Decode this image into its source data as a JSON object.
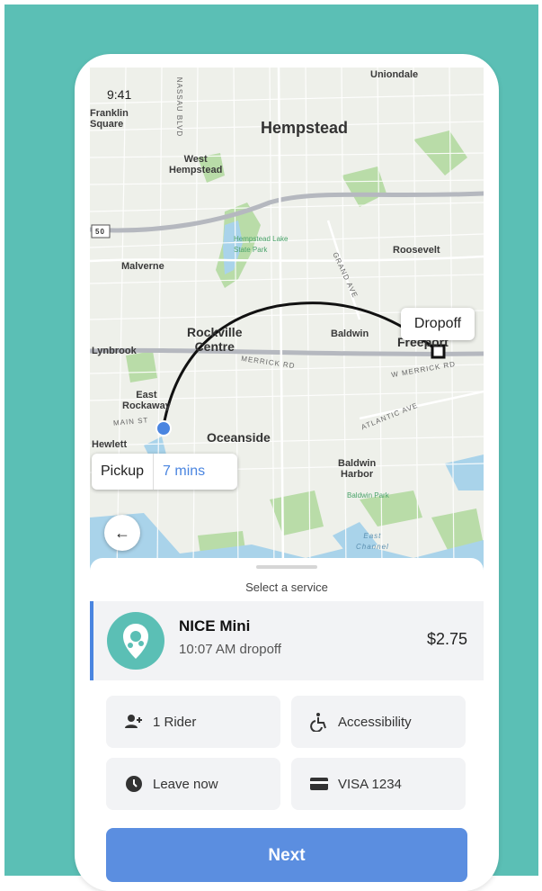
{
  "status": {
    "time": "9:41"
  },
  "map": {
    "labels": {
      "uniondale": "Uniondale",
      "franklin_square": "Franklin\nSquare",
      "nassau_blvd": "NASSAU BLVD",
      "hempstead": "Hempstead",
      "west_hempstead": "West\nHempstead",
      "hempstead_lake": "Hempstead Lake\nState Park",
      "malverne": "Malverne",
      "roosevelt": "Roosevelt",
      "grand_ave": "GRAND AVE",
      "rockville_centre": "Rockville\nCentre",
      "baldwin": "Baldwin",
      "freeport": "Freeport",
      "lynbrook": "Lynbrook",
      "merrick_rd": "MERRICK RD",
      "w_merrick_rd": "W MERRICK RD",
      "east_rockaway": "East\nRockaway",
      "main_st": "MAIN ST",
      "atlantic_ave": "ATLANTIC AVE",
      "hewlett": "Hewlett",
      "oceanside": "Oceanside",
      "baldwin_harbor": "Baldwin\nHarbor",
      "baldwin_park": "Baldwin Park",
      "east_channel": "East\nChannel",
      "route_50": "50"
    },
    "dropoff_label": "Dropoff",
    "pickup_label": "Pickup",
    "pickup_eta": "7 mins",
    "colors": {
      "route": "#111111",
      "pickup_dot": "#4a85e0",
      "park": "#a6d49a",
      "water": "#a9d3ea"
    }
  },
  "sheet": {
    "title": "Select a service",
    "service": {
      "name": "NICE Mini",
      "eta": "10:07 AM dropoff",
      "price": "$2.75",
      "icon": "nice-logo-icon"
    },
    "options": [
      {
        "label": "1 Rider",
        "icon": "add-rider-icon"
      },
      {
        "label": "Accessibility",
        "icon": "wheelchair-icon"
      },
      {
        "label": "Leave now",
        "icon": "clock-icon"
      },
      {
        "label": "VISA 1234",
        "icon": "credit-card-icon"
      }
    ],
    "next_label": "Next"
  },
  "colors": {
    "accent": "#5b8ee0",
    "teal": "#5bbfb5"
  }
}
